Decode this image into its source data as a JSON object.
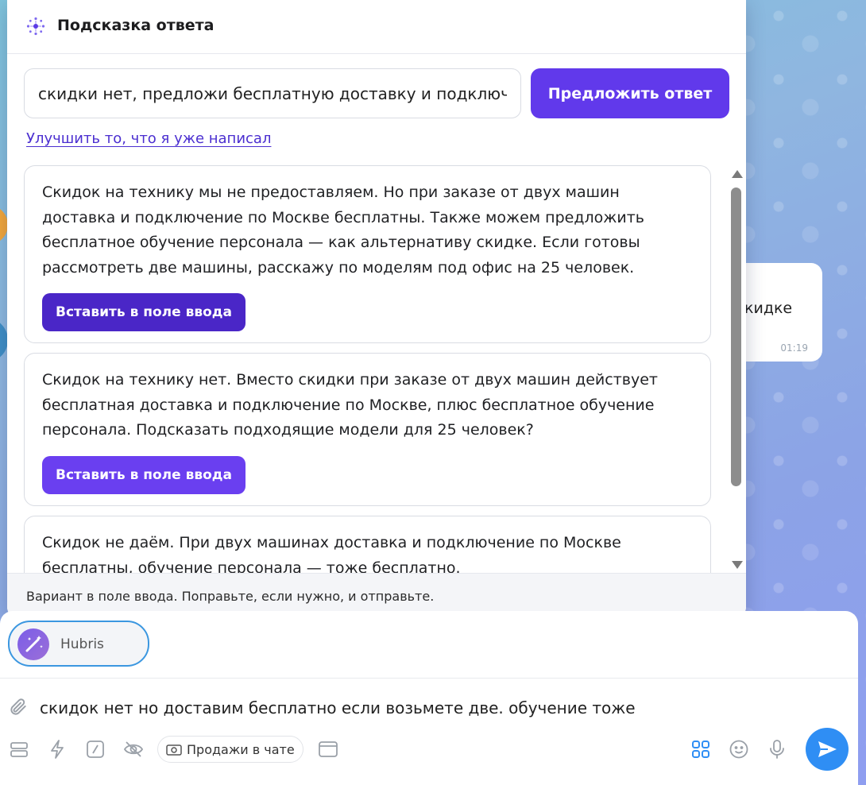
{
  "popup": {
    "title": "Подсказка ответа",
    "prompt_value": "скидки нет, предложи бесплатную доставку и подключение",
    "suggest_button": "Предложить ответ",
    "improve_link": "Улучшить то, что я уже написал",
    "suggestions": [
      {
        "text": "Скидок на технику мы не предоставляем. Но при заказе от двух машин доставка и подключение по Москве бесплатны. Также можем предложить бесплатное обучение персонала — как альтернативу скидке. Если готовы рассмотреть две машины, расскажу по моделям под офис на 25 человек.",
        "button": "Вставить в поле ввода"
      },
      {
        "text": "Скидок на технику нет. Вместо скидки при заказе от двух машин действует бесплатная доставка и подключение по Москве, плюс бесплатное обучение персонала. Подсказать подходящие модели для 25 человек?",
        "button": "Вставить в поле ввода"
      },
      {
        "text": "Скидок не даём. При двух машинах доставка и подключение по Москве бесплатны, обучение персонала — тоже бесплатно."
      }
    ],
    "footer": "Вариант в поле ввода. Поправьте, если нужно, и отправьте."
  },
  "chat_bubble": {
    "text_fragment": "кидке",
    "time": "01:19"
  },
  "composer": {
    "bot_name": "Hubris",
    "message": "скидок нет но доставим бесплатно если возьмете две. обучение тоже",
    "sales_chip": "Продажи в чате"
  },
  "colors": {
    "accent": "#6139eb",
    "accent_pressed": "#4a26c7",
    "send": "#2f8ef4",
    "link": "#4b2fd0"
  }
}
